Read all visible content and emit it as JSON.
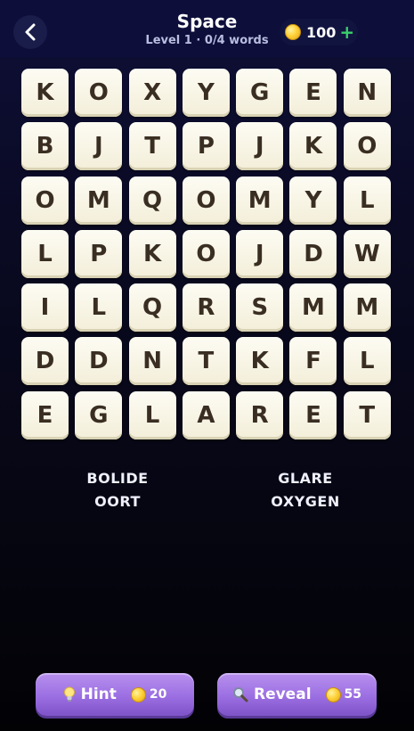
{
  "header": {
    "title": "Space",
    "subtitle": "Level 1 · 0/4 words",
    "coins": "100",
    "coins_plus": "+"
  },
  "grid": [
    [
      "K",
      "O",
      "X",
      "Y",
      "G",
      "E",
      "N"
    ],
    [
      "B",
      "J",
      "T",
      "P",
      "J",
      "K",
      "O"
    ],
    [
      "O",
      "M",
      "Q",
      "O",
      "M",
      "Y",
      "L"
    ],
    [
      "L",
      "P",
      "K",
      "O",
      "J",
      "D",
      "W"
    ],
    [
      "I",
      "L",
      "Q",
      "R",
      "S",
      "M",
      "M"
    ],
    [
      "D",
      "D",
      "N",
      "T",
      "K",
      "F",
      "L"
    ],
    [
      "E",
      "G",
      "L",
      "A",
      "R",
      "E",
      "T"
    ]
  ],
  "words": [
    "BOLIDE",
    "GLARE",
    "OORT",
    "OXYGEN"
  ],
  "buttons": {
    "hint": {
      "label": "Hint",
      "cost": "20",
      "icon": "lightbulb-icon"
    },
    "reveal": {
      "label": "Reveal",
      "cost": "55",
      "icon": "magnifier-icon"
    }
  },
  "colors": {
    "header_bg": "#0d0e3a",
    "tile": "#f7f3e3",
    "letter": "#3a2e22",
    "button": "#a27ae5",
    "plus": "#39d06a"
  }
}
